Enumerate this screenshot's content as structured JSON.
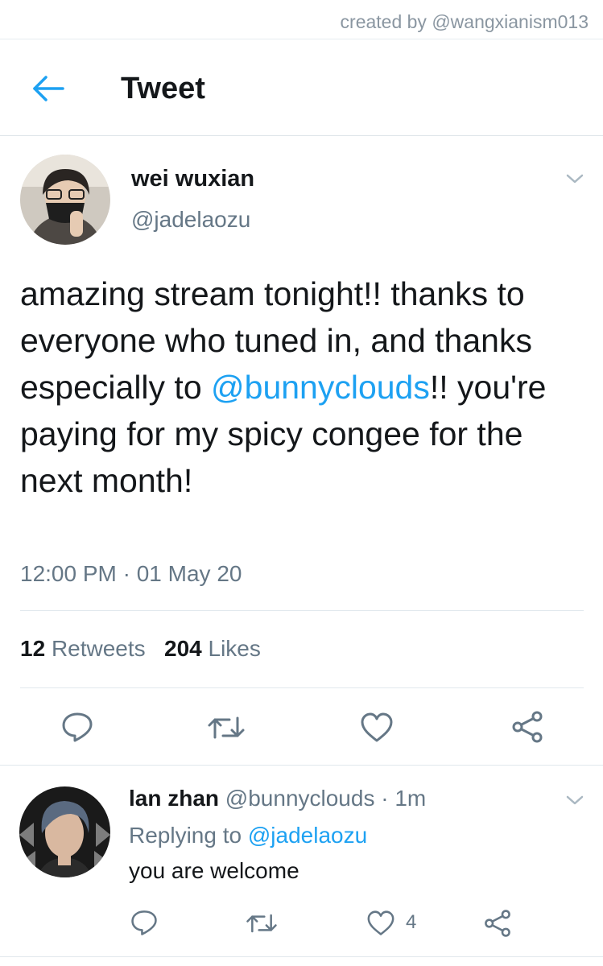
{
  "watermark": "created by @wangxianism013",
  "header": {
    "title": "Tweet",
    "back_icon": "arrow-left-icon"
  },
  "accent_color": "#1da1f2",
  "tweet": {
    "display_name": "wei wuxian",
    "handle": "@jadelaozu",
    "text_before": "amazing stream tonight!! thanks to everyone who tuned in, and thanks especially to ",
    "mention": "@bunnyclouds",
    "text_after": "!! you're paying for my spicy congee for the next month!",
    "timestamp": "12:00 PM · 01 May 20",
    "retweets_count": "12",
    "retweets_label": "Retweets",
    "likes_count": "204",
    "likes_label": "Likes",
    "actions": [
      "reply-icon",
      "retweet-icon",
      "like-icon",
      "share-icon"
    ]
  },
  "reply": {
    "display_name": "lan zhan",
    "handle": "@bunnyclouds",
    "time": "· 1m",
    "replying_label": "Replying to",
    "replying_to": "@jadelaozu",
    "text": "you are welcome",
    "like_count": "4"
  }
}
